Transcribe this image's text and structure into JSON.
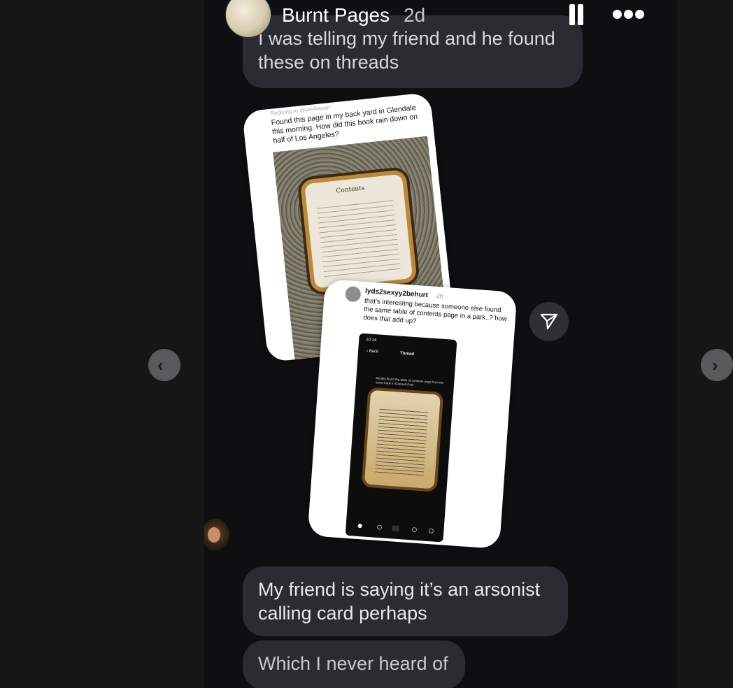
{
  "story": {
    "author": "Burnt Pages",
    "time": "2d",
    "pause_label": "Pause",
    "more_label": "More options"
  },
  "messages": [
    {
      "text": "I was telling my friend and he found these on threads"
    },
    {
      "text": "My friend is saying it’s an arsonist calling card perhaps"
    },
    {
      "text": "Which I never heard of"
    }
  ],
  "card1": {
    "reply_to": "Replying to @yesikasan",
    "caption": "Found this page in my back yard in Glendale this morning. How did this book rain down on half of Los Angeles?",
    "page_title": "Contents"
  },
  "card2": {
    "username": "lyds2sexyy2behurt",
    "time": "2h",
    "text": "that’s interesting because someone else found the same table of contents page in a park..? how does that add up?",
    "phone": {
      "time": "10:14",
      "back": "‹ Back",
      "title": "Thread",
      "post_text": "literally found the table of contents page from the same book in Glassell Park"
    }
  },
  "icons": {
    "send": "send-icon",
    "prev": "chevron-left-icon",
    "next": "chevron-right-icon",
    "pause": "pause-icon",
    "more": "more-horizontal-icon"
  },
  "glyphs": {
    "prev": "‹",
    "next": "›"
  }
}
